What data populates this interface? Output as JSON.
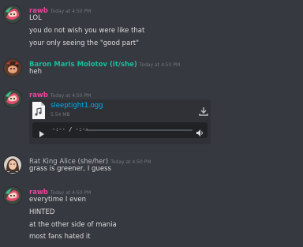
{
  "colors": {
    "background": "#36393f",
    "rawb": "#eb459e",
    "baron": "#1abc9c",
    "alice": "#b9bbbe",
    "link": "#00b0f4"
  },
  "messages": [
    {
      "author": "rawb",
      "timestamp": "Today at 4:50 PM",
      "avatar": "rawb-avatar",
      "lines": [
        "LOL",
        "you do not wish you were like that",
        "your only seeing the \"good part\""
      ]
    },
    {
      "author": "Baron Maris Molotov (it/she)",
      "timestamp": "Today at 4:50 PM",
      "avatar": "baron-avatar",
      "lines": [
        "heh"
      ]
    },
    {
      "author": "rawb",
      "timestamp": "Today at 4:50 PM",
      "avatar": "rawb-avatar",
      "attachment": {
        "file_name": "sleeptight1.ogg",
        "file_size": "5.54 MB",
        "time_readout": "-:-- / -:--",
        "icon_file": "file-icon",
        "icon_download": "download-icon",
        "icon_play": "play-icon",
        "icon_volume": "volume-icon"
      }
    },
    {
      "author": "Rat King Alice (she/her)",
      "timestamp": "Today at 4:50 PM",
      "avatar": "alice-avatar",
      "lines": [
        "grass is greener, I guess"
      ]
    },
    {
      "author": "rawb",
      "timestamp": "Today at 4:50 PM",
      "avatar": "rawb-avatar",
      "lines": [
        "everytime I even",
        "HINTED",
        "at the other side of mania",
        "most fans hated it"
      ]
    }
  ]
}
